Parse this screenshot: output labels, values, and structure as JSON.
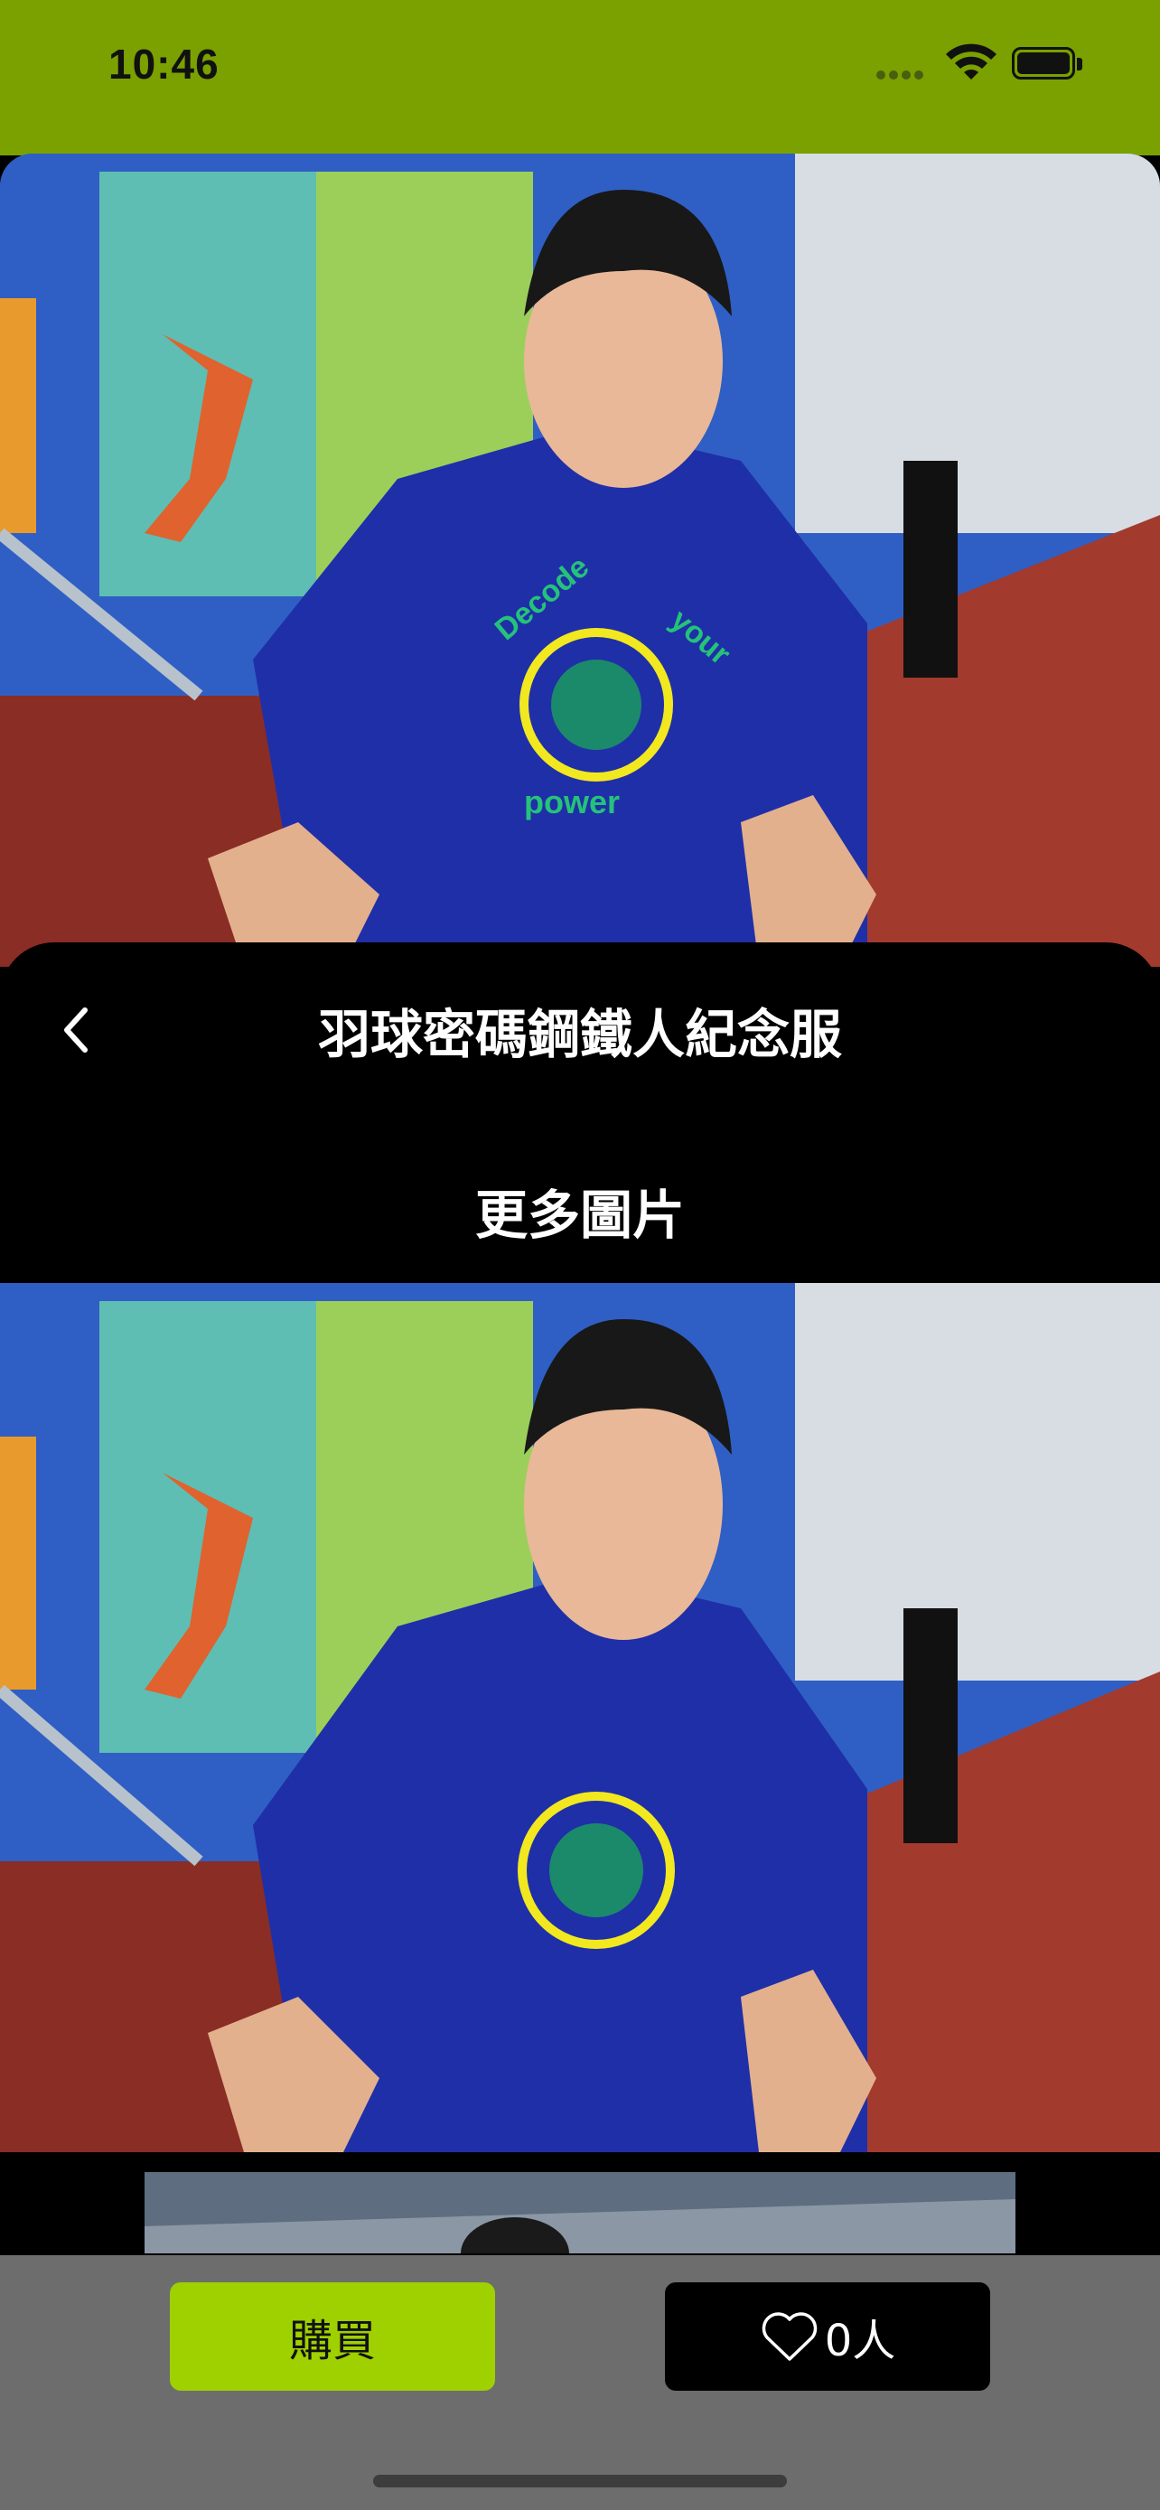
{
  "status_bar": {
    "time": "10:46"
  },
  "header": {
    "title": "羽球密碼鋼鐵人紀念服",
    "back_icon": "chevron-left-icon"
  },
  "section": {
    "more_images_label": "更多圖片"
  },
  "photos": {
    "shirt_print": {
      "line1": "Decode",
      "line2": "your",
      "line3": "power"
    }
  },
  "actions": {
    "buy_label": "購買",
    "like_icon": "heart-outline-icon",
    "like_count": "0人"
  },
  "colors": {
    "accent": "#9fd000",
    "status_bar": "#7aa100",
    "bottom_bar": "#6d6d6d"
  }
}
